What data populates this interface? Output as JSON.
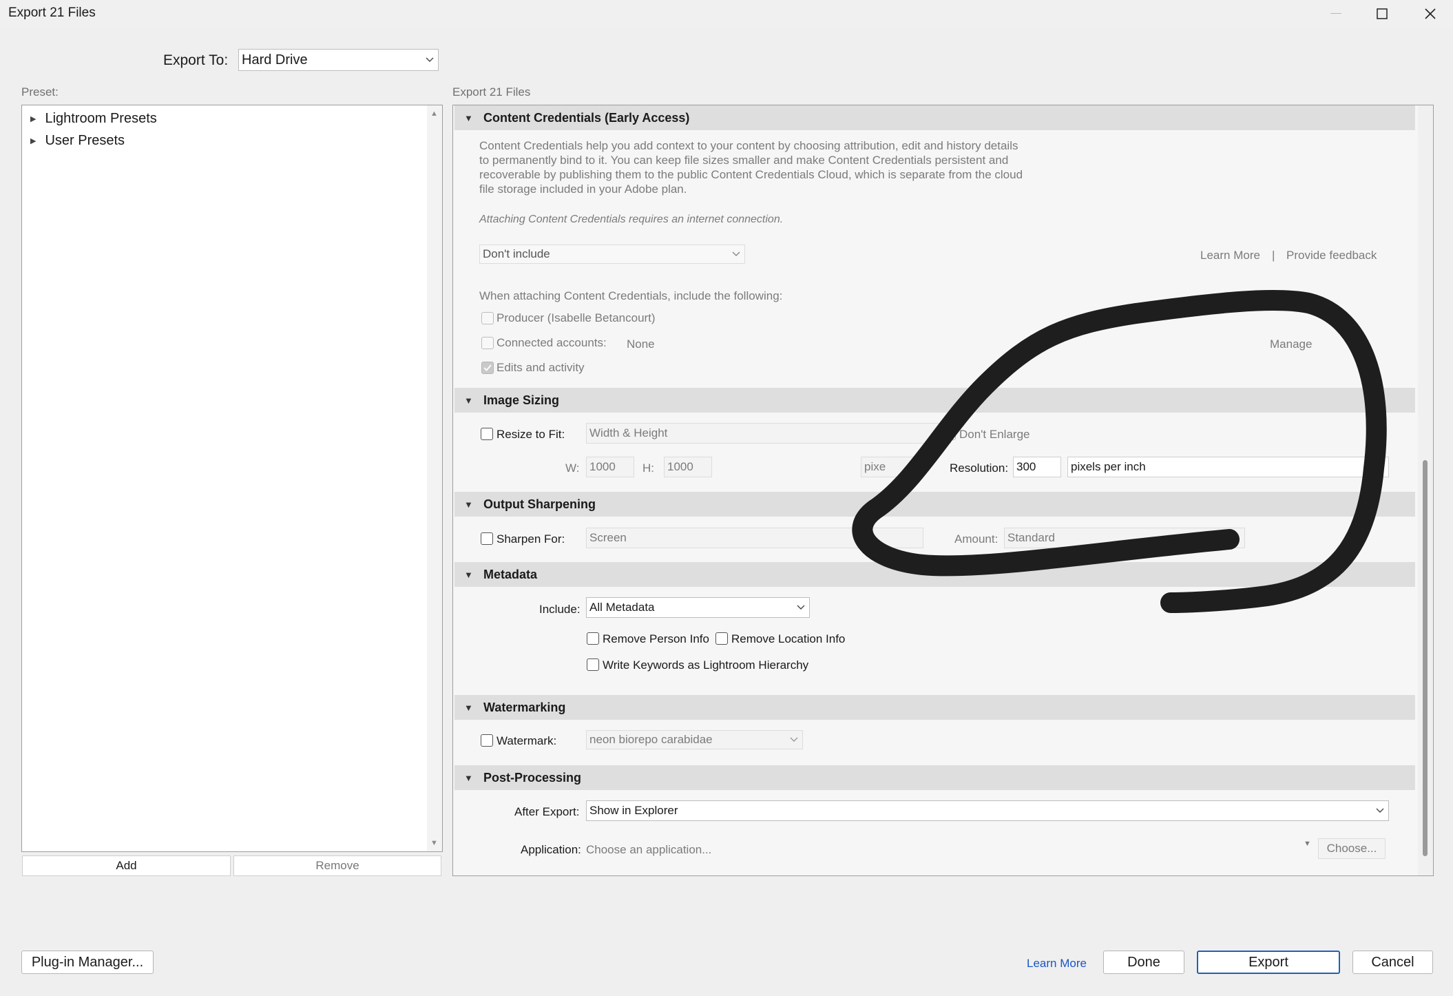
{
  "window": {
    "title": "Export 21 Files",
    "minimize_icon": "minimize-icon",
    "maximize_icon": "maximize-icon",
    "close_icon": "close-icon"
  },
  "export_to": {
    "label": "Export To:",
    "value": "Hard Drive"
  },
  "preset": {
    "label": "Preset:",
    "items": [
      {
        "label": "Lightroom Presets"
      },
      {
        "label": "User Presets"
      }
    ],
    "add_label": "Add",
    "remove_label": "Remove"
  },
  "settings": {
    "header": "Export 21 Files",
    "content_credentials": {
      "title": "Content Credentials (Early Access)",
      "description": [
        "Content Credentials help you add context to your content by choosing attribution, edit and history details",
        "to permanently bind to it. You can keep file sizes smaller and make Content Credentials persistent and",
        "recoverable by publishing them to the public Content Credentials Cloud, which is separate from the cloud",
        "file storage included in your Adobe plan."
      ],
      "note": "Attaching Content Credentials requires an internet connection.",
      "include_select": "Don't include",
      "learn_more": "Learn More",
      "separator": "|",
      "provide_feedback": "Provide feedback",
      "include_following": "When attaching Content Credentials, include the following:",
      "producer": "Producer (Isabelle Betancourt)",
      "connected_accounts": "Connected accounts:",
      "connected_value": "None",
      "manage": "Manage",
      "edits_activity": "Edits and activity"
    },
    "image_sizing": {
      "title": "Image Sizing",
      "resize_label": "Resize to Fit:",
      "resize_mode": "Width & Height",
      "dont_enlarge": "Don't Enlarge",
      "w_label": "W:",
      "w_value": "1000",
      "h_label": "H:",
      "h_value": "1000",
      "unit_partial": "pixe",
      "resolution_label": "Resolution:",
      "resolution_value": "300",
      "resolution_unit": "pixels per inch"
    },
    "output_sharpening": {
      "title": "Output Sharpening",
      "sharpen_label": "Sharpen For:",
      "sharpen_value": "Screen",
      "amount_label": "Amount:",
      "amount_value": "Standard"
    },
    "metadata": {
      "title": "Metadata",
      "include_label": "Include:",
      "include_value": "All Metadata",
      "remove_person": "Remove Person Info",
      "remove_location": "Remove Location Info",
      "write_keywords": "Write Keywords as Lightroom Hierarchy"
    },
    "watermarking": {
      "title": "Watermarking",
      "watermark_label": "Watermark:",
      "watermark_value": "neon biorepo carabidae"
    },
    "post_processing": {
      "title": "Post-Processing",
      "after_export_label": "After Export:",
      "after_export_value": "Show in Explorer",
      "application_label": "Application:",
      "application_placeholder": "Choose an application...",
      "choose_label": "Choose..."
    }
  },
  "footer": {
    "plugin_manager": "Plug-in Manager...",
    "learn_more": "Learn More",
    "done": "Done",
    "export": "Export",
    "cancel": "Cancel"
  },
  "colors": {
    "accent": "#1f5fb8",
    "link": "#1a56c4",
    "annotation": "#1e1e1e"
  }
}
